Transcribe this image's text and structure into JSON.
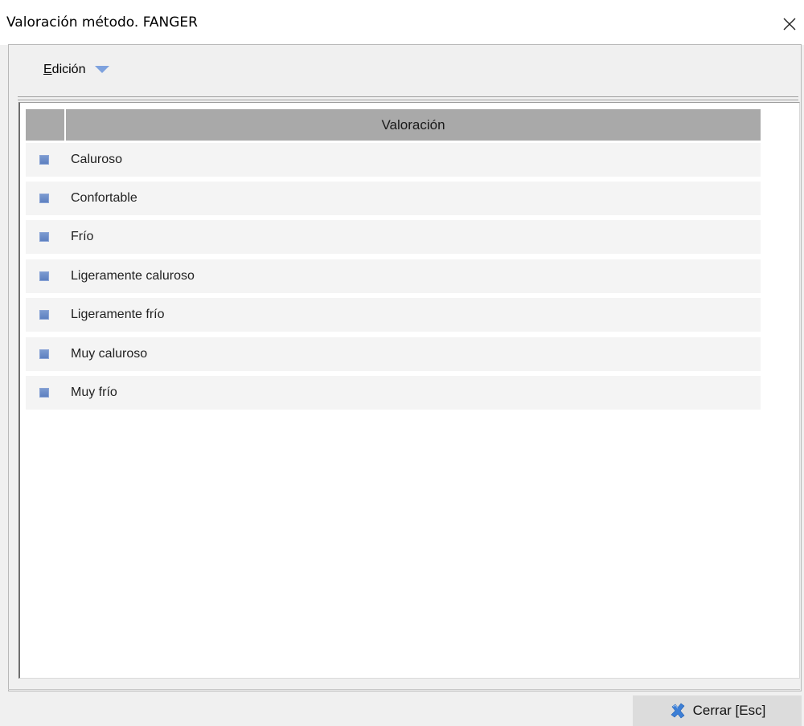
{
  "window": {
    "title": "Valoración método. FANGER"
  },
  "menu": {
    "edicion_label": "Edición",
    "edicion_accesskey": "E",
    "edicion_rest": "dición"
  },
  "grid": {
    "column_header": "Valoración",
    "rows": [
      {
        "label": "Caluroso"
      },
      {
        "label": "Confortable"
      },
      {
        "label": "Frío"
      },
      {
        "label": "Ligeramente caluroso"
      },
      {
        "label": "Ligeramente frío"
      },
      {
        "label": "Muy caluroso"
      },
      {
        "label": "Muy frío"
      }
    ]
  },
  "footer": {
    "close_button_label": "Cerrar [Esc]"
  },
  "icons": {
    "close": "close-icon",
    "dropdown": "triangle-down-icon",
    "row_bullet": "square-bullet-icon",
    "close_button": "x-icon"
  },
  "colors": {
    "header_bg": "#a9a9a9",
    "row_bg": "#f4f4f4",
    "bullet": "#6d8fcf",
    "menu_arrow": "#7ea2de",
    "close_x_blue": "#3d7fd6"
  }
}
